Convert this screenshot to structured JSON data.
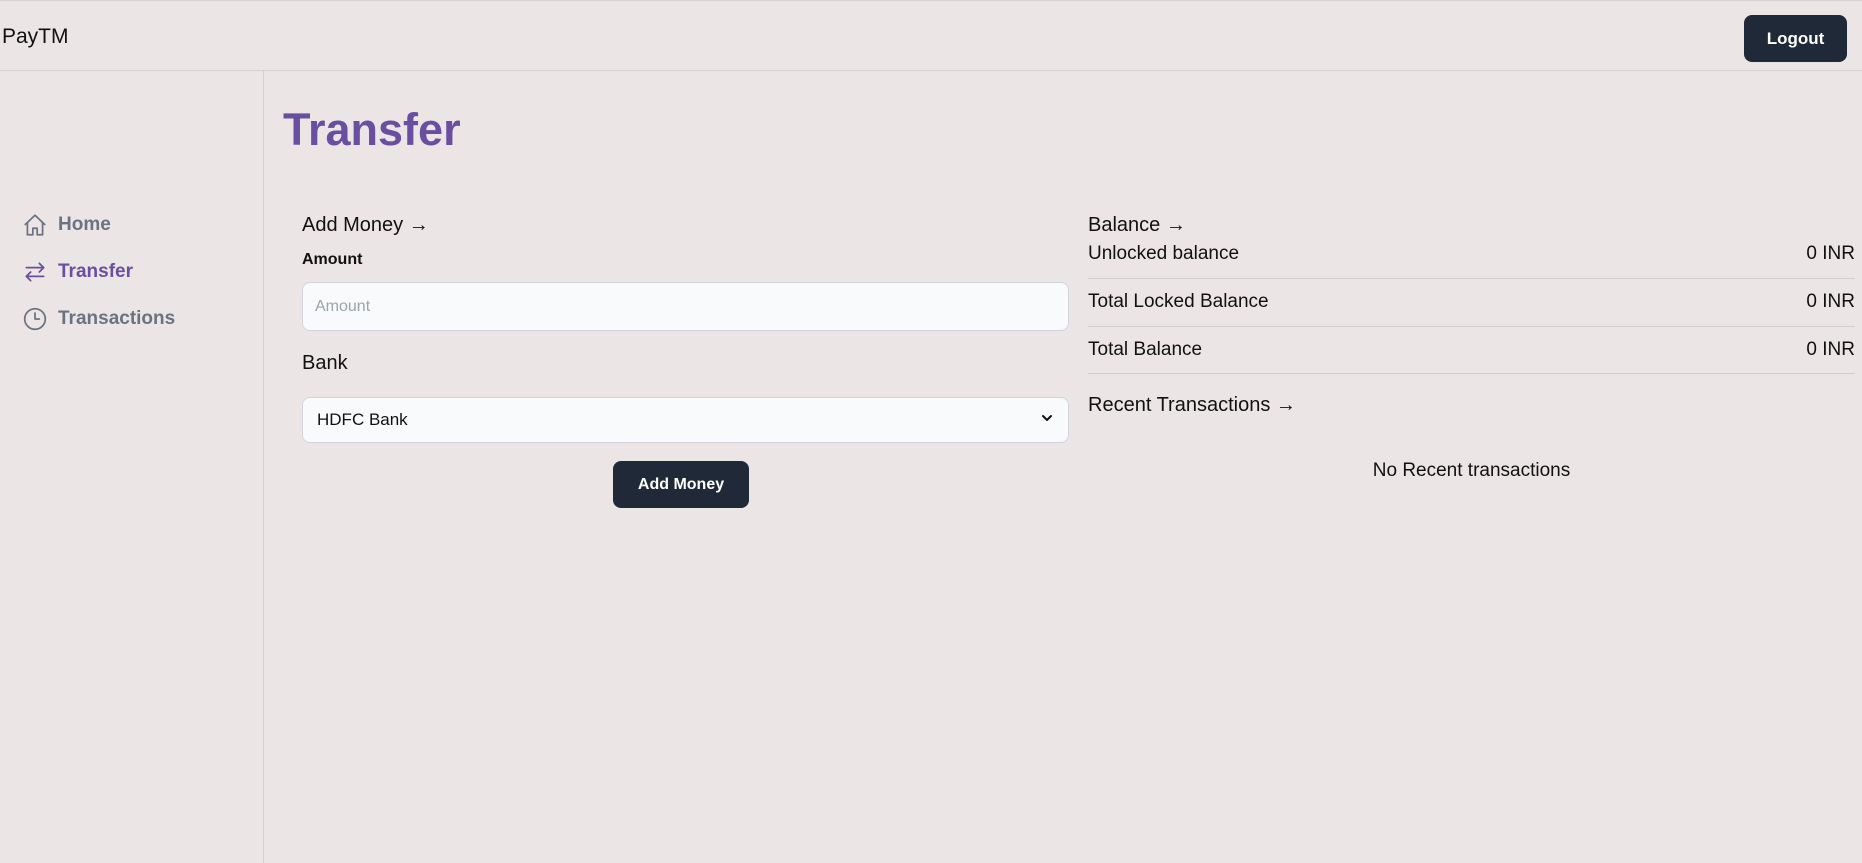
{
  "app": {
    "brand": "PayTM"
  },
  "header": {
    "logout_label": "Logout"
  },
  "sidebar": {
    "items": [
      {
        "label": "Home",
        "icon": "home-icon",
        "active": false
      },
      {
        "label": "Transfer",
        "icon": "transfer-arrows-icon",
        "active": true
      },
      {
        "label": "Transactions",
        "icon": "clock-icon",
        "active": false
      }
    ]
  },
  "page": {
    "title": "Transfer"
  },
  "add_money": {
    "heading": "Add Money →",
    "amount_label": "Amount",
    "amount_placeholder": "Amount",
    "amount_value": "",
    "bank_label": "Bank",
    "bank_selected": "HDFC Bank",
    "submit_label": "Add Money"
  },
  "balance": {
    "heading": "Balance →",
    "rows": [
      {
        "label": "Unlocked balance",
        "value": "0 INR"
      },
      {
        "label": "Total Locked Balance",
        "value": "0 INR"
      },
      {
        "label": "Total Balance",
        "value": "0 INR"
      }
    ]
  },
  "recent_transactions": {
    "heading": "Recent Transactions →",
    "empty_text": "No Recent transactions"
  },
  "colors": {
    "background": "#ebe6e5",
    "accent": "#6a4ea0",
    "button": "#1f2937",
    "muted_nav": "#6b7280"
  }
}
